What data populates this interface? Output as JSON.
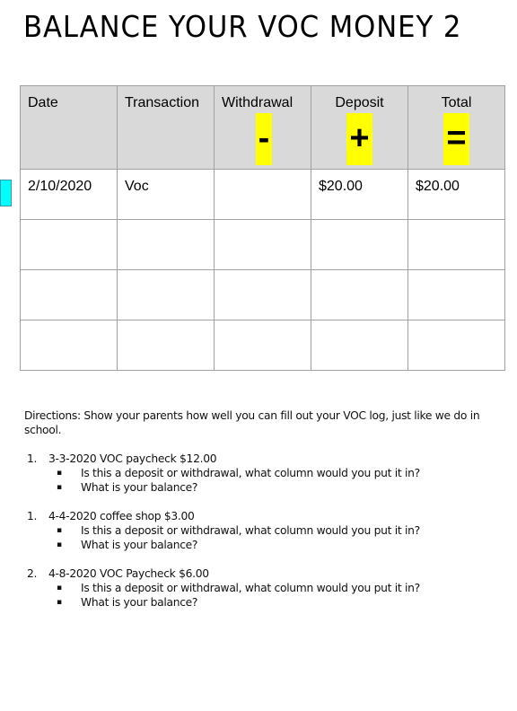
{
  "title": "BALANCE YOUR VOC MONEY 2",
  "marker": {
    "color": "#00ffff"
  },
  "ledger": {
    "headers": [
      {
        "label": "Date",
        "symbol": ""
      },
      {
        "label": "Transaction",
        "symbol": ""
      },
      {
        "label": "Withdrawal",
        "symbol": "-"
      },
      {
        "label": "Deposit",
        "symbol": "+"
      },
      {
        "label": "Total",
        "symbol": "="
      }
    ],
    "rows": [
      [
        "2/10/2020",
        "Voc",
        "",
        "$20.00",
        "$20.00"
      ],
      [
        "",
        "",
        "",
        "",
        ""
      ],
      [
        "",
        "",
        "",
        "",
        ""
      ],
      [
        "",
        "",
        "",
        "",
        ""
      ]
    ],
    "header_bg": "#d9d9d9",
    "symbol_highlight": "#ffff00"
  },
  "directions": {
    "intro": "Directions: Show your parents how well you can fill out your VOC log, just like we do in school.",
    "items": [
      {
        "number": "1.",
        "text": "3-3-2020  VOC paycheck $12.00",
        "questions": [
          "Is this a deposit or withdrawal, what column would you put it in?",
          "What is your balance?"
        ]
      },
      {
        "number": "1.",
        "text": "4-4-2020 coffee shop  $3.00",
        "questions": [
          "Is this a deposit or withdrawal, what column would you put it in?",
          "What is your balance?"
        ]
      },
      {
        "number": "2.",
        "text": "4-8-2020  VOC Paycheck  $6.00",
        "questions": [
          "Is this a deposit or withdrawal, what column would you put it in?",
          "What is your balance?"
        ]
      }
    ]
  }
}
